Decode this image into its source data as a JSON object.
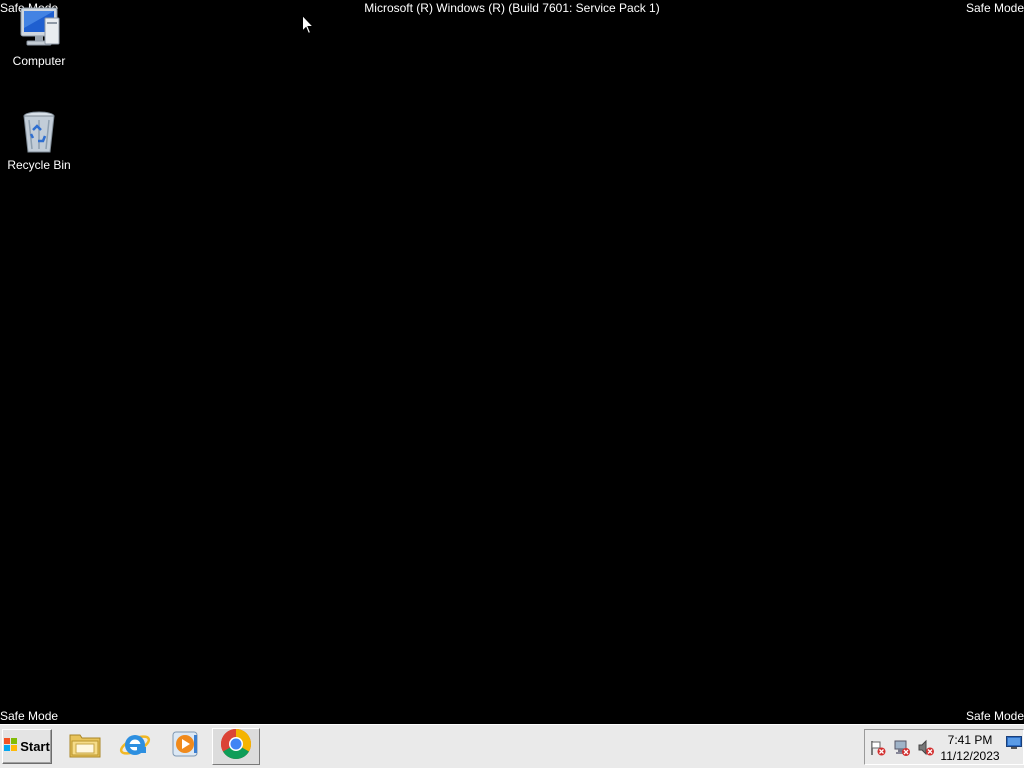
{
  "overlay": {
    "safe_mode_tl": "Safe Mode",
    "safe_mode_tr": "Safe Mode",
    "safe_mode_bl": "Safe Mode",
    "safe_mode_br": "Safe Mode",
    "build": "Microsoft (R) Windows (R) (Build 7601: Service Pack 1)"
  },
  "desktop": {
    "icons": [
      {
        "label": "Computer",
        "icon": "computer-icon"
      },
      {
        "label": "Recycle Bin",
        "icon": "recycle-bin-icon"
      }
    ]
  },
  "taskbar": {
    "start_label": "Start",
    "pinned": [
      {
        "icon": "windows-explorer-icon"
      },
      {
        "icon": "internet-explorer-icon"
      },
      {
        "icon": "windows-media-player-icon"
      },
      {
        "icon": "chrome-icon"
      }
    ],
    "tray": {
      "icons": [
        "action-center-flag-icon",
        "network-disconnected-icon",
        "volume-muted-icon"
      ],
      "time": "7:41 PM",
      "date": "11/12/2023"
    }
  },
  "colors": {
    "desktop_bg": "#000000",
    "taskbar_bg": "#eaeaea"
  }
}
